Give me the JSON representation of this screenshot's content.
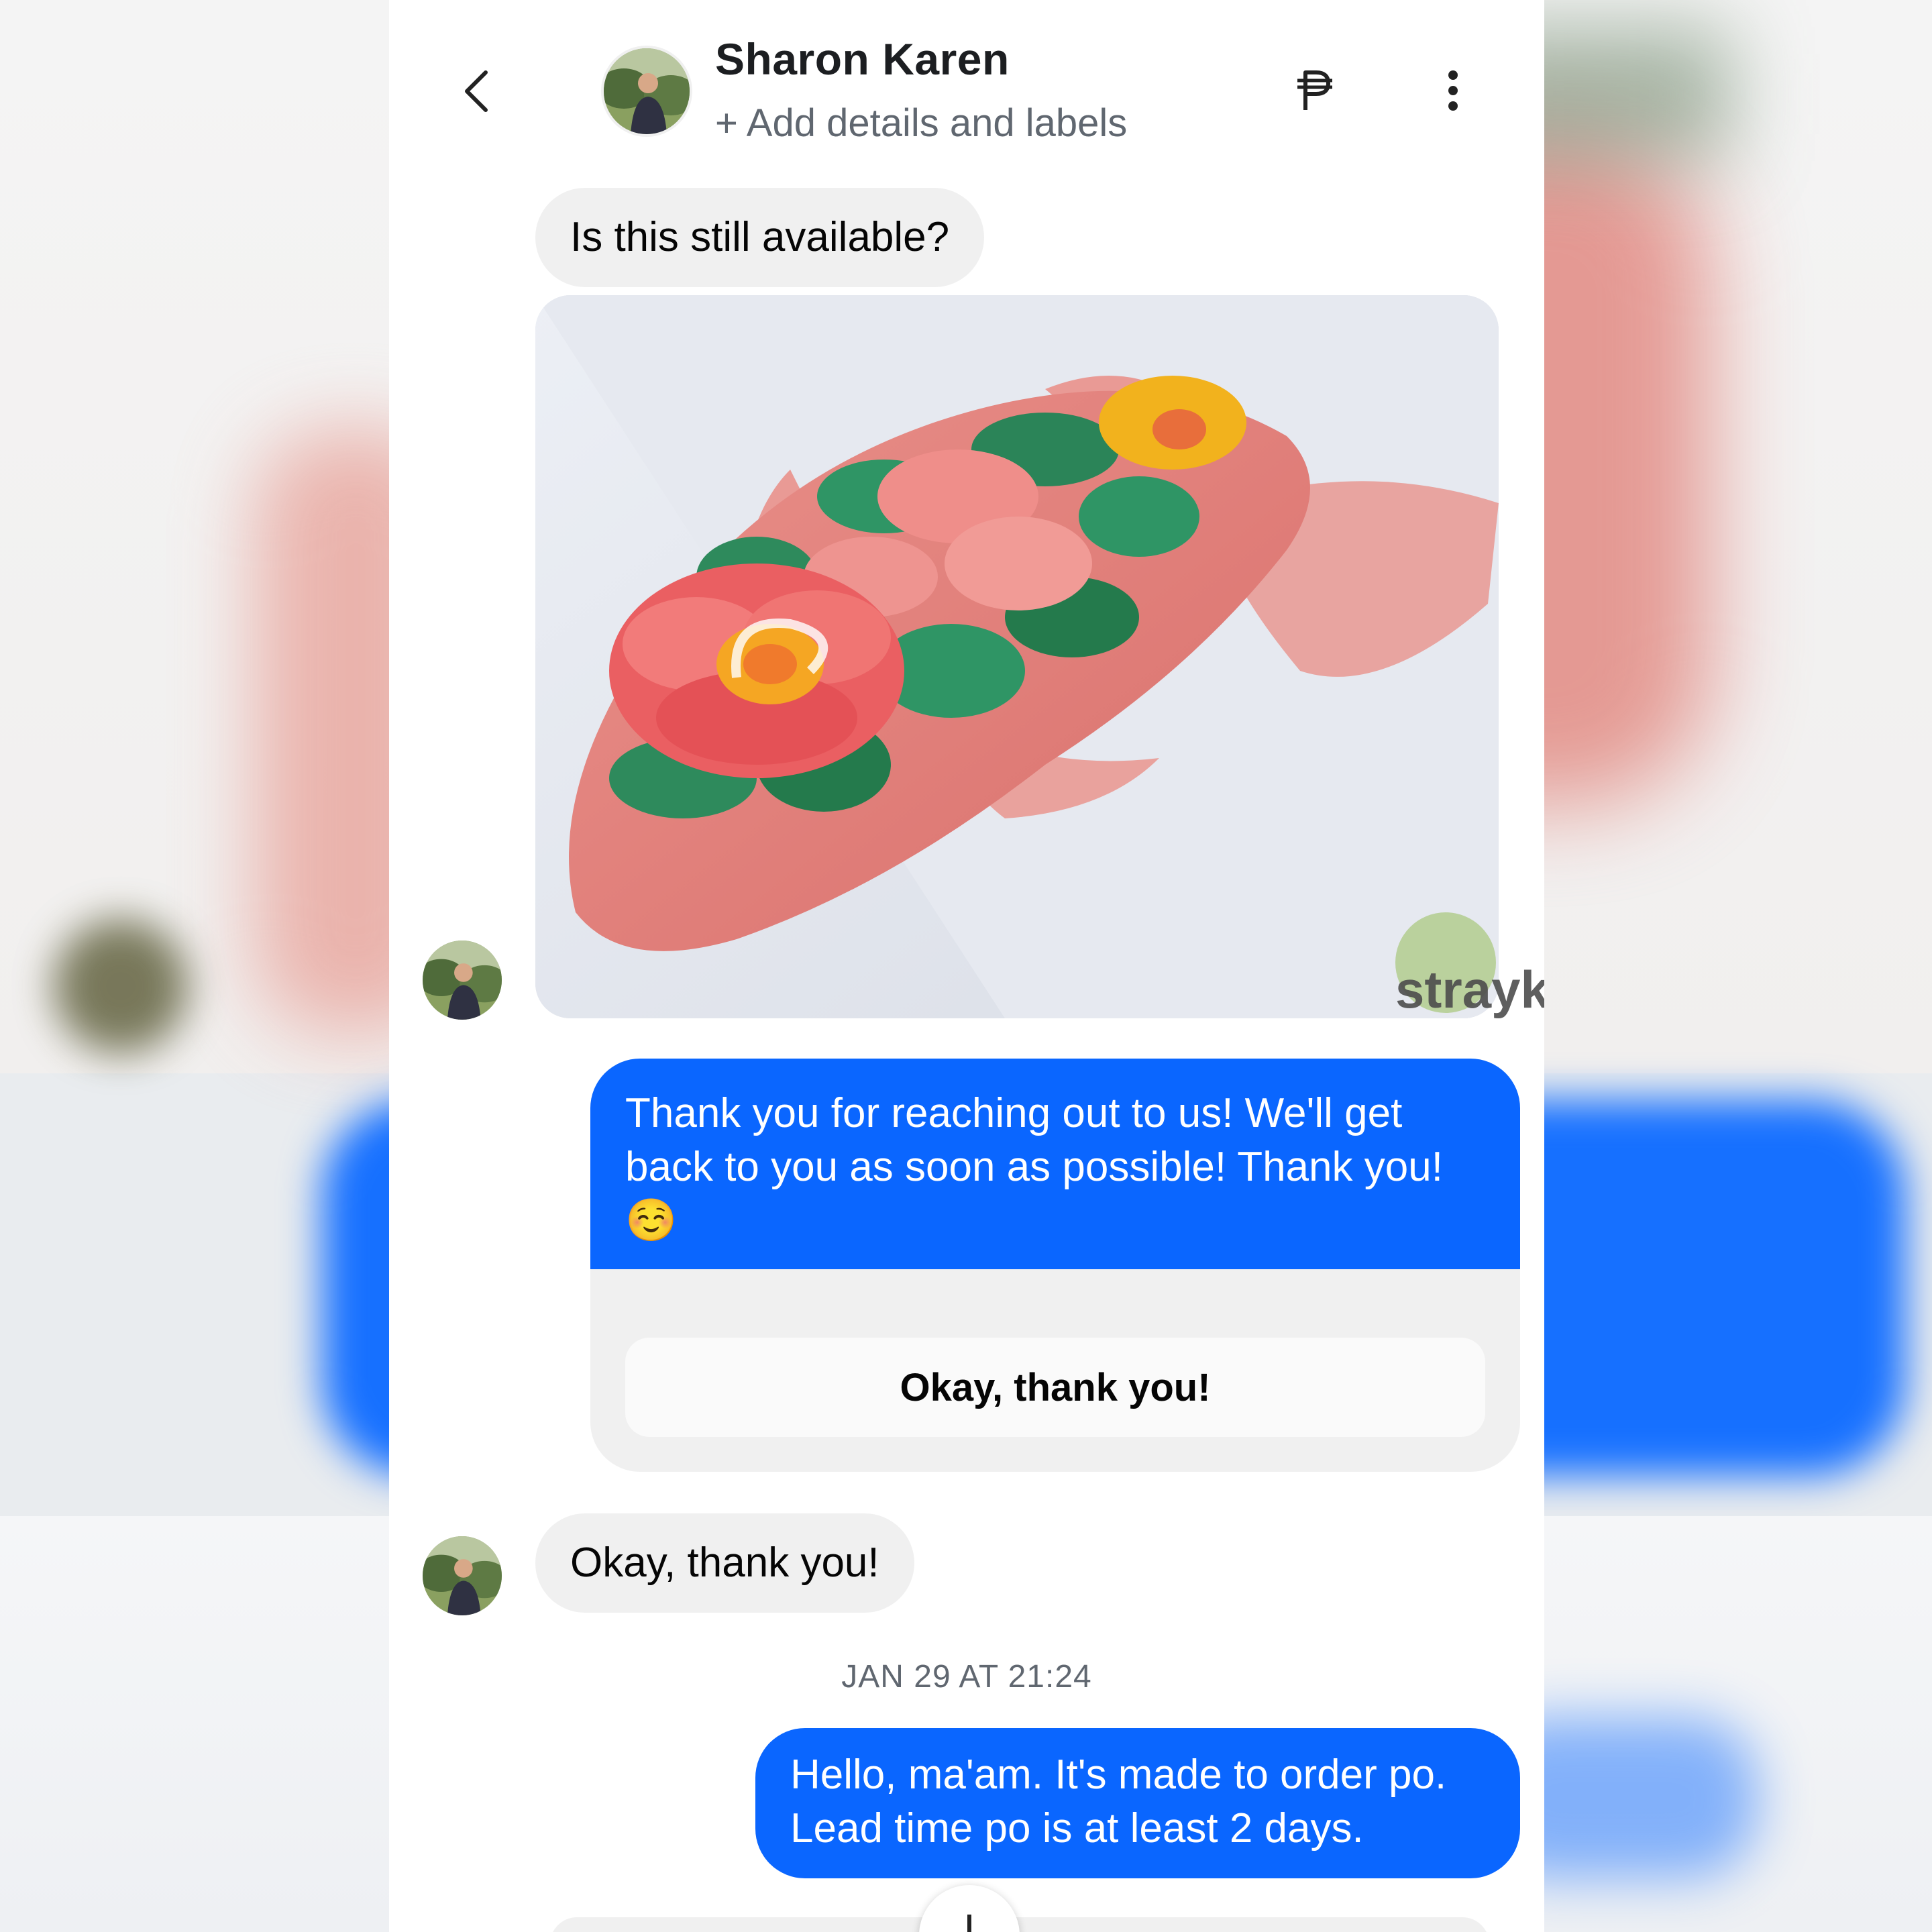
{
  "header": {
    "contact_name": "Sharon Karen",
    "subtitle": "+ Add details and labels",
    "back_icon": "chevron-left-icon",
    "currency_icon": "peso-icon",
    "more_icon": "kebab-menu-icon"
  },
  "messages": {
    "incoming_1": "Is this still available?",
    "outgoing_auto": "Thank you for reaching out to us! We'll get back to you as soon as possible! Thank you! ☺️",
    "quick_reply": "Okay, thank you!",
    "incoming_2": "Okay, thank you!",
    "timestamp": "JAN 29 AT 21:24",
    "outgoing_2": "Hello, ma'am. It's made to order po. Lead time po is at least 2 days."
  },
  "watermark": {
    "text": "straykat"
  },
  "colors": {
    "outgoing_bubble": "#0a66ff",
    "incoming_bubble": "#f0f0f0"
  }
}
